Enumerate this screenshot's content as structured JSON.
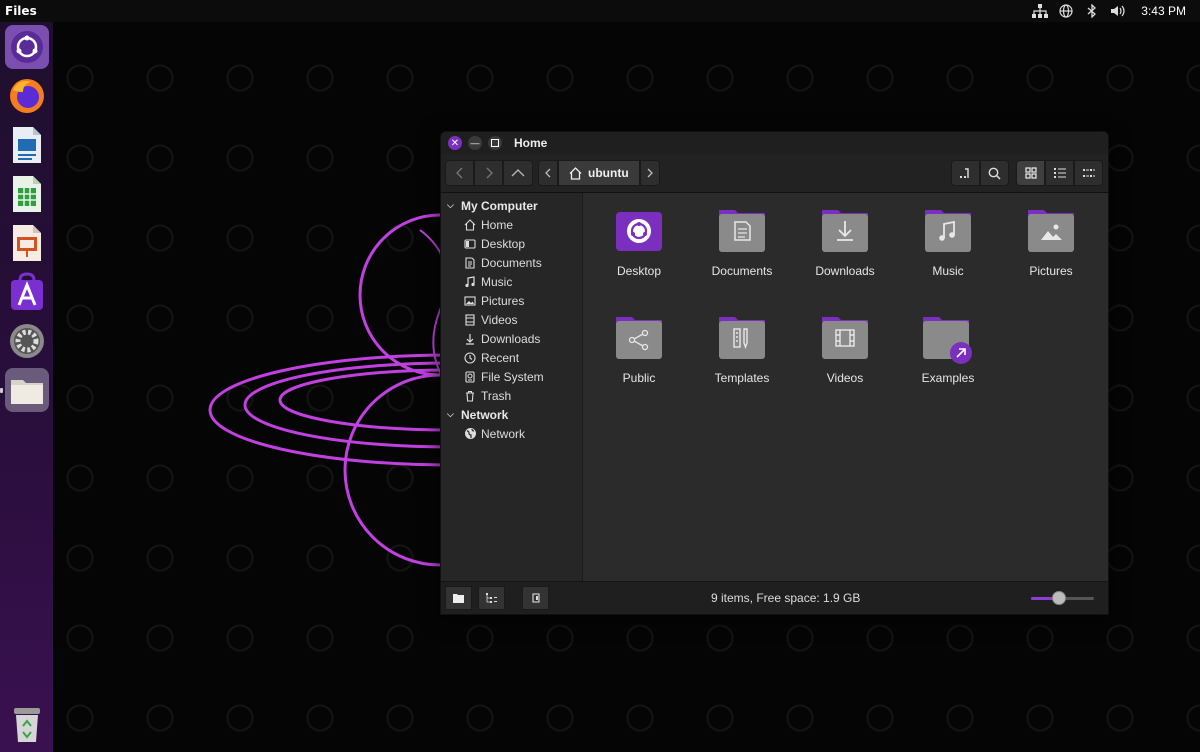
{
  "topbar": {
    "app_name": "Files",
    "clock": "3:43 PM",
    "icons": [
      "network-icon",
      "globe-icon",
      "bluetooth-icon",
      "volume-icon"
    ]
  },
  "dock": {
    "items": [
      "ubuntu-icon",
      "firefox-icon",
      "writer-icon",
      "calc-icon",
      "impress-icon",
      "app-center-icon",
      "settings-icon",
      "files-icon"
    ],
    "trash": "trash-icon"
  },
  "window": {
    "title": "Home",
    "path_label": "ubuntu",
    "status": "9 items, Free space: 1.9 GB",
    "zoom_level": 0.45,
    "accent": "#7b2fbe"
  },
  "sidebar": {
    "sections": [
      {
        "label": "My Computer",
        "items": [
          {
            "label": "Home",
            "icon": "home-icon"
          },
          {
            "label": "Desktop",
            "icon": "desktop-icon"
          },
          {
            "label": "Documents",
            "icon": "documents-icon"
          },
          {
            "label": "Music",
            "icon": "music-icon"
          },
          {
            "label": "Pictures",
            "icon": "pictures-icon"
          },
          {
            "label": "Videos",
            "icon": "videos-icon"
          },
          {
            "label": "Downloads",
            "icon": "downloads-icon"
          },
          {
            "label": "Recent",
            "icon": "recent-icon"
          },
          {
            "label": "File System",
            "icon": "drive-icon"
          },
          {
            "label": "Trash",
            "icon": "trash-icon"
          }
        ]
      },
      {
        "label": "Network",
        "items": [
          {
            "label": "Network",
            "icon": "network-globe-icon"
          }
        ]
      }
    ]
  },
  "files": [
    {
      "label": "Desktop",
      "icon": "desktop"
    },
    {
      "label": "Documents",
      "icon": "documents"
    },
    {
      "label": "Downloads",
      "icon": "downloads"
    },
    {
      "label": "Music",
      "icon": "music"
    },
    {
      "label": "Pictures",
      "icon": "pictures"
    },
    {
      "label": "Public",
      "icon": "public"
    },
    {
      "label": "Templates",
      "icon": "templates"
    },
    {
      "label": "Videos",
      "icon": "videos"
    },
    {
      "label": "Examples",
      "icon": "link"
    }
  ]
}
